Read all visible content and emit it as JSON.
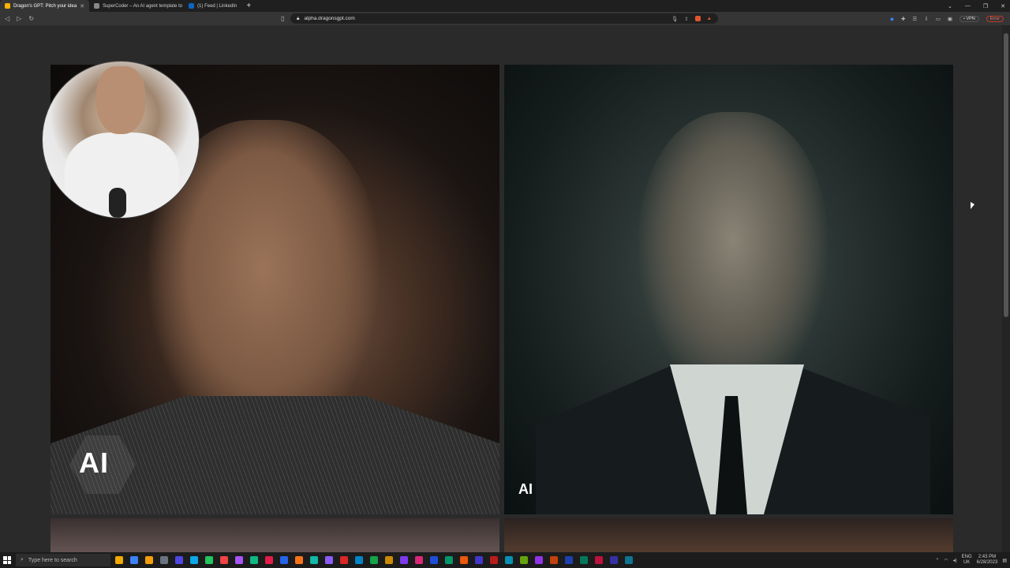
{
  "browser": {
    "tabs": [
      {
        "title": "Dragon's GPT: Pitch your idea",
        "favicon_color": "#ffb400",
        "active": true
      },
      {
        "title": "SuperCoder – An AI agent template to",
        "favicon_color": "#888888",
        "active": false
      },
      {
        "title": "(1) Feed | LinkedIn",
        "favicon_color": "#0a66c2",
        "active": false
      }
    ],
    "new_tab": "+",
    "url": "alpha.dragonsgpt.com",
    "vpn_label": "• VPN",
    "error_label": "Error"
  },
  "content": {
    "badges": {
      "left": "AI",
      "right": "AI"
    }
  },
  "taskbar": {
    "search_placeholder": "Type here to search",
    "lang_line1": "ENG",
    "lang_line2": "UK",
    "time": "2:43 PM",
    "date": "6/28/2023",
    "app_colors": [
      "#f2a900",
      "#3b82f6",
      "#f59e0b",
      "#6b7280",
      "#4f46e5",
      "#0ea5e9",
      "#22c55e",
      "#ef4444",
      "#a855f7",
      "#10b981",
      "#e11d48",
      "#2563eb",
      "#f97316",
      "#14b8a6",
      "#8b5cf6",
      "#dc2626",
      "#0284c7",
      "#16a34a",
      "#ca8a04",
      "#7c3aed",
      "#db2777",
      "#1d4ed8",
      "#059669",
      "#ea580c",
      "#4338ca",
      "#b91c1c",
      "#0891b2",
      "#65a30d",
      "#9333ea",
      "#c2410c",
      "#1e40af",
      "#047857",
      "#be123c",
      "#3730a3",
      "#0e7490"
    ]
  }
}
